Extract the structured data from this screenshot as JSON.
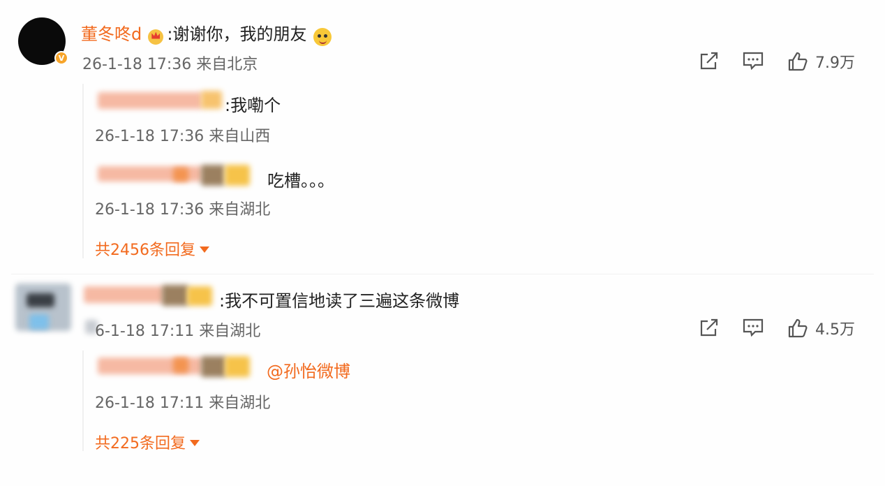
{
  "comment1": {
    "username": "董冬咚d",
    "text": ":谢谢你，我的朋友",
    "meta": "26-1-18 17:36 来自北京",
    "likes": "7.9万",
    "replies": [
      {
        "text": ":我嘞个",
        "meta": "26-1-18 17:36 来自山西"
      },
      {
        "text": "吃槽。。。",
        "meta": "26-1-18 17:36 来自湖北"
      }
    ],
    "more_replies": "共2456条回复"
  },
  "comment2": {
    "text": ":我不可置信地读了三遍这条微博",
    "meta": "6-1-18 17:11 来自湖北",
    "likes": "4.5万",
    "replies": [
      {
        "text": "@孙怡微博",
        "meta": "26-1-18 17:11 来自湖北"
      }
    ],
    "more_replies": "共225条回复"
  },
  "icons": {
    "share": "share-icon",
    "comment": "comment-icon",
    "like": "thumbs-up-icon"
  },
  "colors": {
    "accent": "#f26a1e"
  }
}
